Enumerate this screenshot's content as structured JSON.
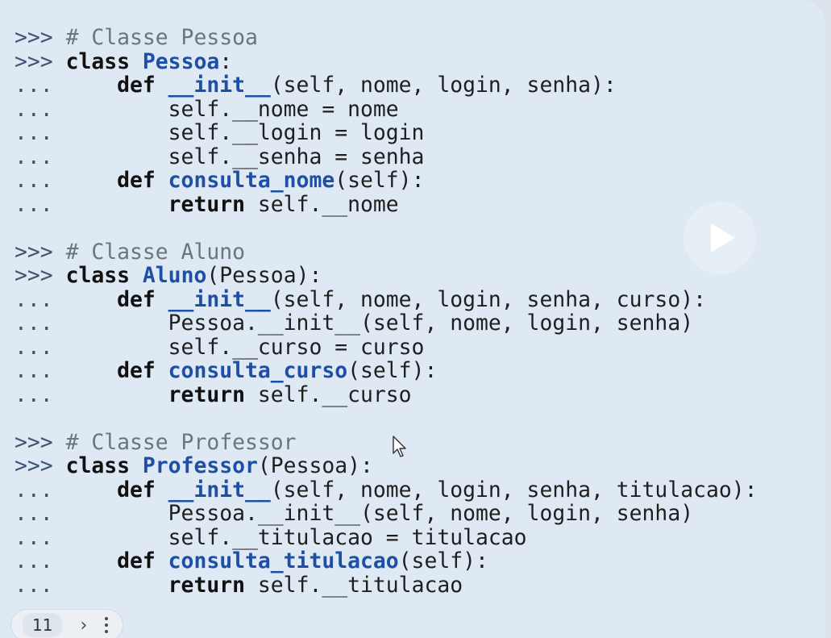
{
  "code_lines": [
    [
      {
        "t": ">>> ",
        "c": "p"
      },
      {
        "t": "# Classe Pessoa",
        "c": "c"
      }
    ],
    [
      {
        "t": ">>> ",
        "c": "p"
      },
      {
        "t": "class ",
        "c": "k"
      },
      {
        "t": "Pessoa",
        "c": "f"
      },
      {
        "t": ":",
        "c": "n"
      }
    ],
    [
      {
        "t": "...     ",
        "c": "p"
      },
      {
        "t": "def ",
        "c": "k"
      },
      {
        "t": "__init__",
        "c": "f"
      },
      {
        "t": "(self, nome, login, senha):",
        "c": "n"
      }
    ],
    [
      {
        "t": "...         ",
        "c": "p"
      },
      {
        "t": "self.__nome = nome",
        "c": "n"
      }
    ],
    [
      {
        "t": "...         ",
        "c": "p"
      },
      {
        "t": "self.__login = login",
        "c": "n"
      }
    ],
    [
      {
        "t": "...         ",
        "c": "p"
      },
      {
        "t": "self.__senha = senha",
        "c": "n"
      }
    ],
    [
      {
        "t": "...     ",
        "c": "p"
      },
      {
        "t": "def ",
        "c": "k"
      },
      {
        "t": "consulta_nome",
        "c": "f"
      },
      {
        "t": "(self):",
        "c": "n"
      }
    ],
    [
      {
        "t": "...         ",
        "c": "p"
      },
      {
        "t": "return ",
        "c": "k"
      },
      {
        "t": "self.__nome",
        "c": "n"
      }
    ],
    [],
    [
      {
        "t": ">>> ",
        "c": "p"
      },
      {
        "t": "# Classe Aluno",
        "c": "c"
      }
    ],
    [
      {
        "t": ">>> ",
        "c": "p"
      },
      {
        "t": "class ",
        "c": "k"
      },
      {
        "t": "Aluno",
        "c": "f"
      },
      {
        "t": "(Pessoa):",
        "c": "n"
      }
    ],
    [
      {
        "t": "...     ",
        "c": "p"
      },
      {
        "t": "def ",
        "c": "k"
      },
      {
        "t": "__init__",
        "c": "f"
      },
      {
        "t": "(self, nome, login, senha, curso):",
        "c": "n"
      }
    ],
    [
      {
        "t": "...         ",
        "c": "p"
      },
      {
        "t": "Pessoa.__init__(self, nome, login, senha)",
        "c": "n"
      }
    ],
    [
      {
        "t": "...         ",
        "c": "p"
      },
      {
        "t": "self.__curso = curso",
        "c": "n"
      }
    ],
    [
      {
        "t": "...     ",
        "c": "p"
      },
      {
        "t": "def ",
        "c": "k"
      },
      {
        "t": "consulta_curso",
        "c": "f"
      },
      {
        "t": "(self):",
        "c": "n"
      }
    ],
    [
      {
        "t": "...         ",
        "c": "p"
      },
      {
        "t": "return ",
        "c": "k"
      },
      {
        "t": "self.__curso",
        "c": "n"
      }
    ],
    [],
    [
      {
        "t": ">>> ",
        "c": "p"
      },
      {
        "t": "# Classe Professor",
        "c": "c"
      }
    ],
    [
      {
        "t": ">>> ",
        "c": "p"
      },
      {
        "t": "class ",
        "c": "k"
      },
      {
        "t": "Professor",
        "c": "f"
      },
      {
        "t": "(Pessoa):",
        "c": "n"
      }
    ],
    [
      {
        "t": "...     ",
        "c": "p"
      },
      {
        "t": "def ",
        "c": "k"
      },
      {
        "t": "__init__",
        "c": "f"
      },
      {
        "t": "(self, nome, login, senha, titulacao):",
        "c": "n"
      }
    ],
    [
      {
        "t": "...         ",
        "c": "p"
      },
      {
        "t": "Pessoa.__init__(self, nome, login, senha)",
        "c": "n"
      }
    ],
    [
      {
        "t": "...         ",
        "c": "p"
      },
      {
        "t": "self.__titulacao = titulacao",
        "c": "n"
      }
    ],
    [
      {
        "t": "...     ",
        "c": "p"
      },
      {
        "t": "def ",
        "c": "k"
      },
      {
        "t": "consulta_titulacao",
        "c": "f"
      },
      {
        "t": "(self):",
        "c": "n"
      }
    ],
    [
      {
        "t": "...         ",
        "c": "p"
      },
      {
        "t": "return ",
        "c": "k"
      },
      {
        "t": "self.__titulacao",
        "c": "n"
      }
    ]
  ],
  "pager": {
    "page_number": "11",
    "next_icon": "chevron-right-icon",
    "menu_icon": "more-vertical-icon"
  },
  "overlay": {
    "play_icon": "play-icon"
  },
  "colors": {
    "panel_background": "#dfe9f4",
    "prompt": "#3d5475",
    "comment": "#6b7581",
    "keyword": "#111111",
    "identifier": "#1d4fa6"
  }
}
